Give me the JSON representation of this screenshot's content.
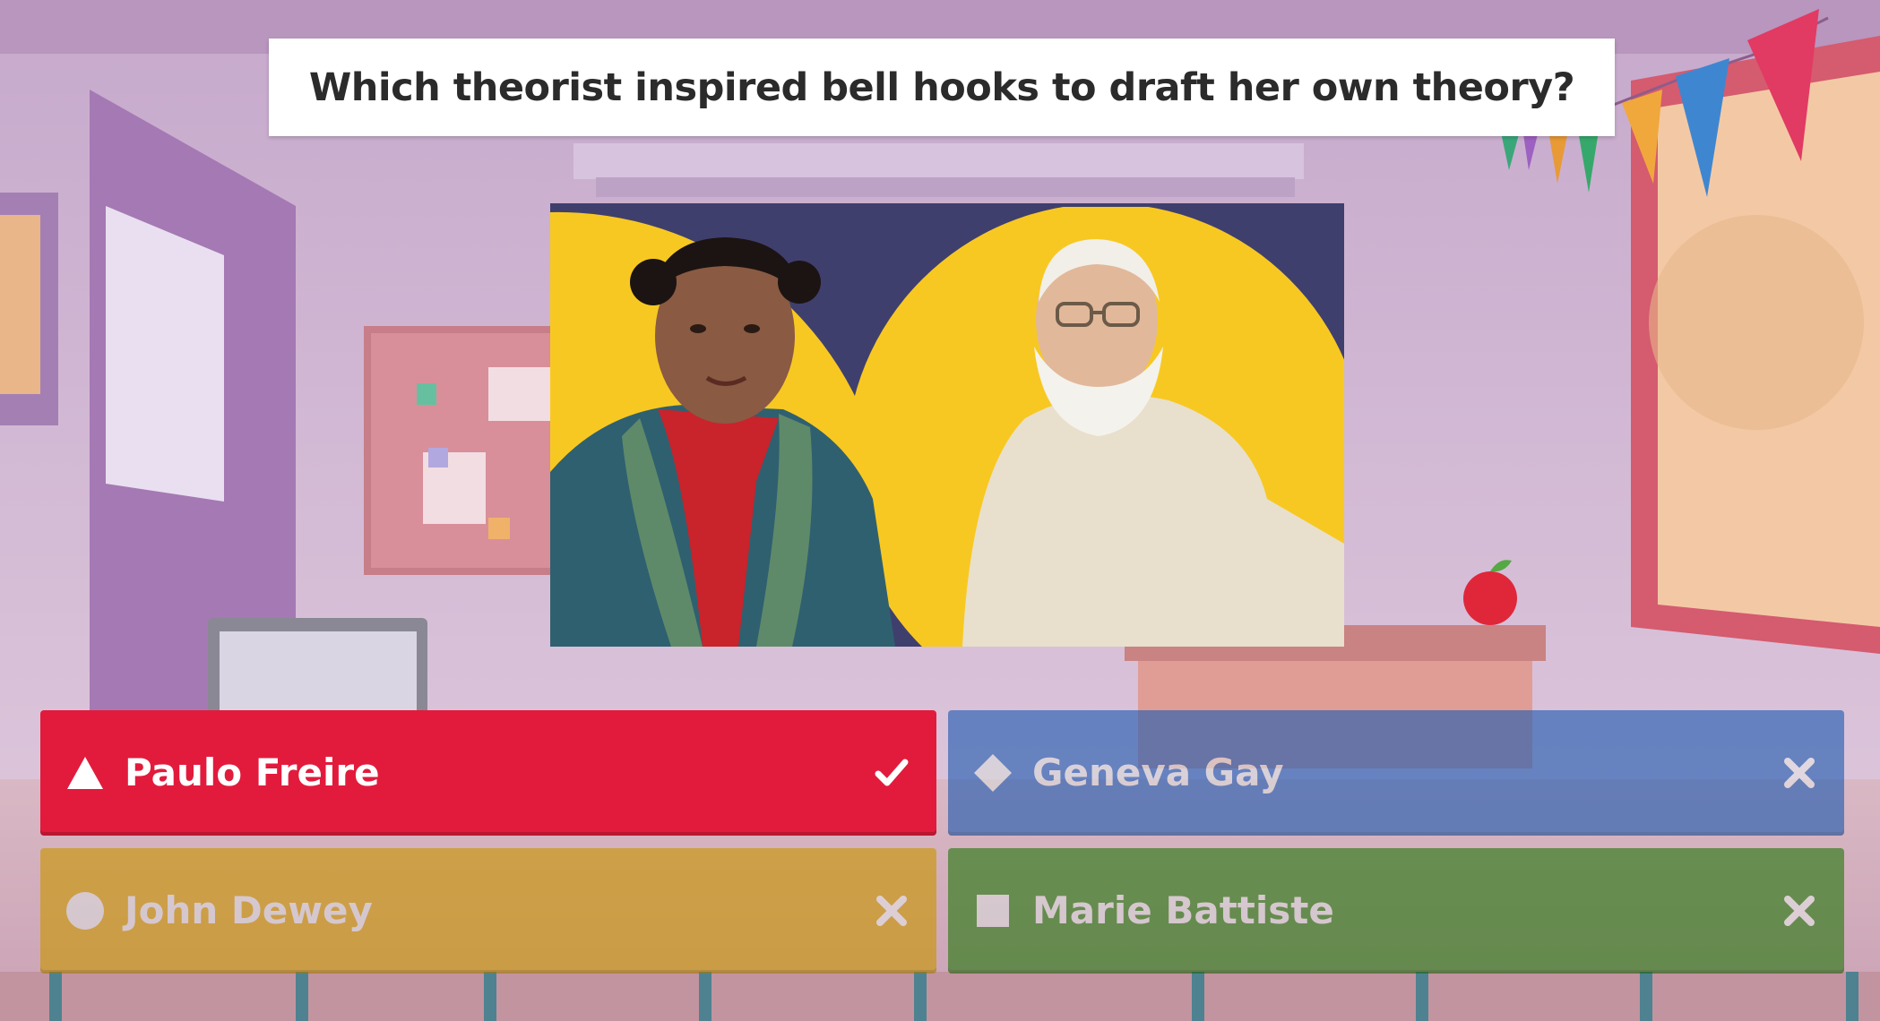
{
  "question": {
    "text": "Which theorist inspired bell hooks to draft her own theory?"
  },
  "answers": [
    {
      "label": "Paulo Freire",
      "shape": "triangle-icon",
      "color": "#e21b3c",
      "correct": true
    },
    {
      "label": "Geneva Gay",
      "shape": "diamond-icon",
      "color": "#1f5ab0",
      "correct": false
    },
    {
      "label": "John Dewey",
      "shape": "circle-icon",
      "color": "#c99600",
      "correct": false
    },
    {
      "label": "Marie Battiste",
      "shape": "square-icon",
      "color": "#26780e",
      "correct": false
    }
  ],
  "colors": {
    "image_background": "#3f3f6e",
    "image_circles": "#f8c822"
  }
}
